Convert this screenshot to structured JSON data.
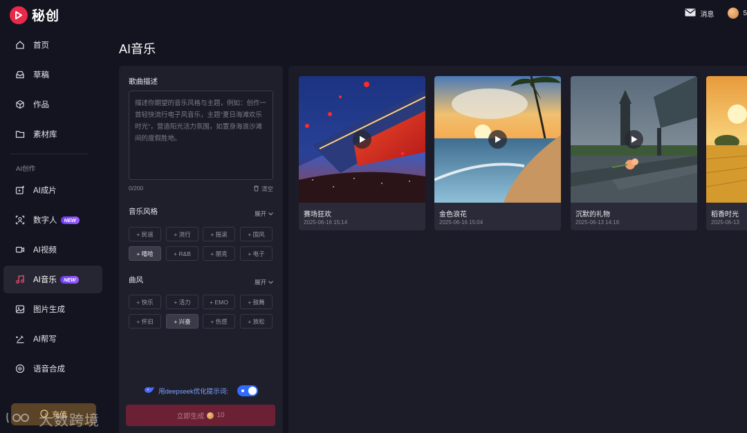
{
  "header": {
    "app_name": "秘创",
    "messages_label": "消息",
    "credits": "5"
  },
  "sidebar": {
    "items": [
      {
        "label": "首页",
        "icon": "home-icon"
      },
      {
        "label": "草稿",
        "icon": "drafts-icon"
      },
      {
        "label": "作品",
        "icon": "works-icon"
      },
      {
        "label": "素材库",
        "icon": "library-icon"
      },
      {
        "label": "AI成片",
        "icon": "ai-film-icon"
      },
      {
        "label": "数字人",
        "icon": "digital-human-icon",
        "badge": "NEW"
      },
      {
        "label": "AI视频",
        "icon": "video-icon"
      },
      {
        "label": "AI音乐",
        "icon": "music-icon",
        "badge": "NEW",
        "active": true
      },
      {
        "label": "图片生成",
        "icon": "image-icon"
      },
      {
        "label": "AI帮写",
        "icon": "write-icon"
      },
      {
        "label": "语音合成",
        "icon": "voice-icon"
      }
    ],
    "section_label": "AI创作",
    "recharge_label": "充值"
  },
  "page": {
    "title": "AI音乐"
  },
  "form": {
    "description_label": "歌曲描述",
    "description_placeholder": "描述你期望的音乐风格与主题，例如：创作一首轻快流行电子风音乐，主题\"夏日海滩欢乐时光\"，营造阳光活力氛围，如置身海浪沙滩间的度假胜地。",
    "char_count": "0/200",
    "clear_label": "清空",
    "style_label": "音乐风格",
    "expand_label": "展开",
    "styles": [
      "+ 民谣",
      "+ 流行",
      "+ 摇滚",
      "+ 国风",
      "+ 嘻哈",
      "+ R&B",
      "+ 朋克",
      "+ 电子"
    ],
    "selected_style": "+ 嘻哈",
    "mood_label": "曲风",
    "moods": [
      "+ 快乐",
      "+ 活力",
      "+ EMO",
      "+ 鼓舞",
      "+ 怀旧",
      "+ 兴奋",
      "+ 伤感",
      "+ 放松"
    ],
    "selected_mood": "+ 兴奋",
    "deepseek_label": "用deepseek优化提示词:",
    "deepseek_enabled": true,
    "generate_label": "立即生成",
    "generate_cost": "10"
  },
  "gallery": {
    "cards": [
      {
        "title": "赛场狂欢",
        "date": "2025-06-16 15:14"
      },
      {
        "title": "金色浪花",
        "date": "2025-06-16 15:04"
      },
      {
        "title": "沉默的礼物",
        "date": "2025-06-13 14:16"
      },
      {
        "title": "稻香时光",
        "date": "2025-06-13"
      }
    ]
  },
  "watermark": {
    "text": "大数跨境"
  },
  "colors": {
    "accent": "#e8294a",
    "toggle": "#2f6bff",
    "badge": "#7b4cf5",
    "generate_button": "#6b2034"
  }
}
